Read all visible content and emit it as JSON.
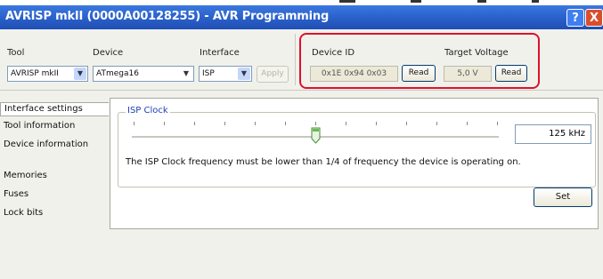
{
  "window": {
    "title": "AVRISP mkII (0000A00128255) - AVR Programming",
    "help_label": "?",
    "close_label": "X"
  },
  "toolbar": {
    "tool_label": "Tool",
    "tool_value": "AVRISP mkII",
    "device_label": "Device",
    "device_value": "ATmega16",
    "interface_label": "Interface",
    "interface_value": "ISP",
    "apply_label": "Apply",
    "device_id_label": "Device ID",
    "device_id_value": "0x1E 0x94 0x03",
    "device_id_read": "Read",
    "target_voltage_label": "Target Voltage",
    "target_voltage_value": "5,0 V",
    "target_voltage_read": "Read"
  },
  "sidebar": {
    "items": [
      {
        "label": "Interface settings"
      },
      {
        "label": "Tool information"
      },
      {
        "label": "Device information"
      },
      {
        "label": "Memories"
      },
      {
        "label": "Fuses"
      },
      {
        "label": "Lock bits"
      }
    ]
  },
  "isp_clock": {
    "legend": "ISP Clock",
    "slider_fraction": 0.5,
    "value": "125 kHz",
    "hint": "The ISP Clock frequency must be lower than 1/4 of frequency the device is operating on.",
    "set_label": "Set"
  },
  "colors": {
    "titlebar": "#2a5fc8",
    "highlight": "#e0102a",
    "legend": "#1e3fb8"
  }
}
